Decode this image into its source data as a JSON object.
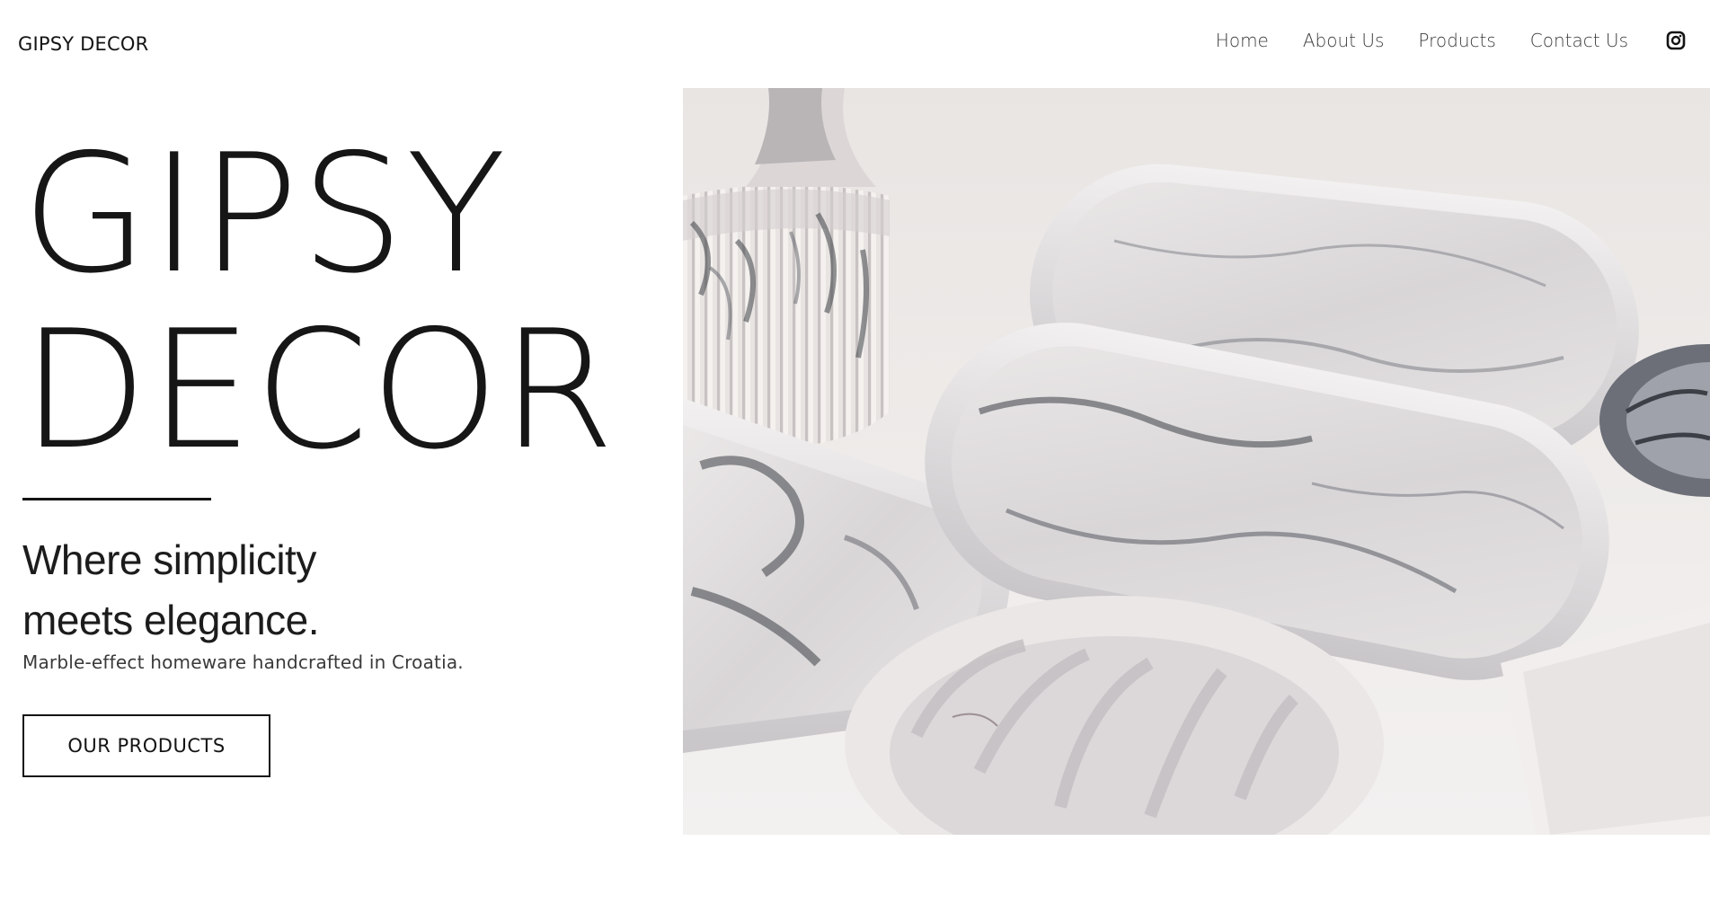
{
  "header": {
    "logo": "GIPSY DECOR",
    "nav": [
      "Home",
      "About Us",
      "Products",
      "Contact Us"
    ],
    "social_icon": "instagram-icon"
  },
  "hero": {
    "title": "GIPSY\nDECOR",
    "tagline": "Where simplicity\nmeets elegance.",
    "subtext": "Marble-effect homeware handcrafted in Croatia.",
    "cta_label": "OUR PRODUCTS",
    "image_subject": "marble-effect trays, ribbed jar and shell dishes"
  },
  "colors": {
    "text": "#141414",
    "nav_text": "#3a3a3a",
    "background": "#ffffff",
    "image_bg": "#ece8e6",
    "marble_light": "#e4e1e1",
    "marble_vein": "#3c3f46"
  }
}
